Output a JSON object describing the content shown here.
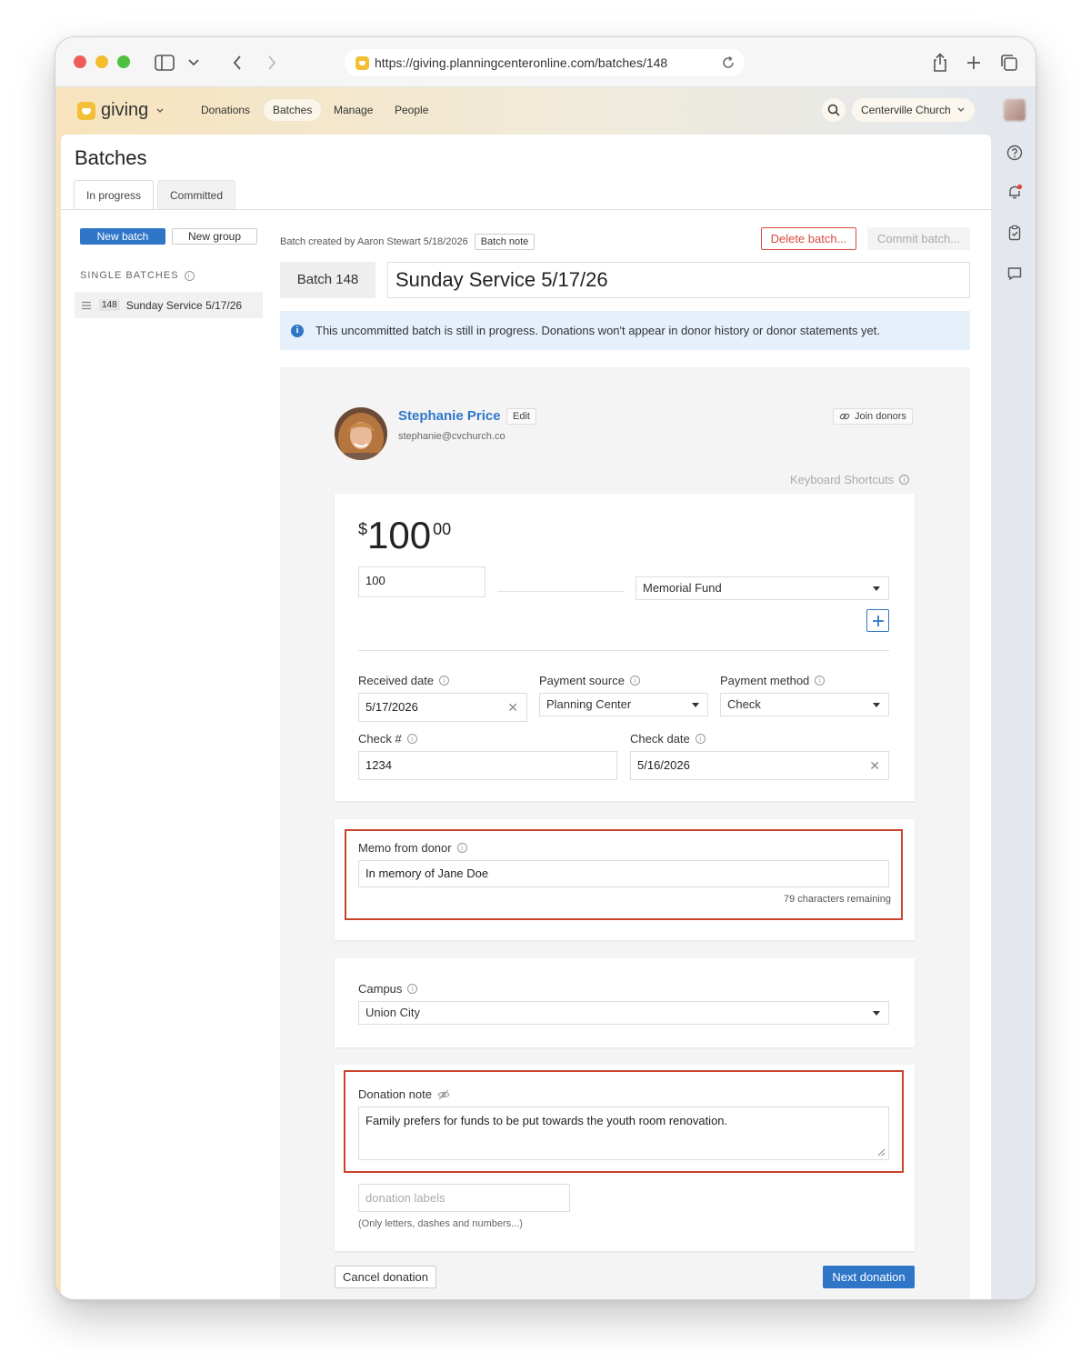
{
  "browser": {
    "url": "https://giving.planningcenteronline.com/batches/148"
  },
  "app": {
    "name": "giving",
    "nav": [
      "Donations",
      "Batches",
      "Manage",
      "People"
    ],
    "active_nav": "Batches",
    "organization": "Centerville Church"
  },
  "page": {
    "title": "Batches",
    "tabs": [
      "In progress",
      "Committed"
    ],
    "active_tab": "In progress"
  },
  "sidebar": {
    "new_batch": "New batch",
    "new_group": "New group",
    "heading": "SINGLE BATCHES",
    "items": [
      {
        "number": "148",
        "name": "Sunday Service 5/17/26"
      }
    ]
  },
  "batch": {
    "meta": "Batch created by Aaron Stewart 5/18/2026",
    "note_button": "Batch note",
    "delete_button": "Delete batch...",
    "commit_button": "Commit batch...",
    "number_label": "Batch 148",
    "name": "Sunday Service 5/17/26",
    "info": "This uncommitted batch is still in progress. Donations won't appear in donor history or donor statements yet."
  },
  "donor": {
    "name": "Stephanie Price",
    "edit": "Edit",
    "email": "stephanie@cvchurch.co",
    "join": "Join donors"
  },
  "shortcuts": "Keyboard Shortcuts",
  "donation": {
    "amount_symbol": "$",
    "amount_whole": "100",
    "amount_cents": "00",
    "amount_input": "100",
    "fund": "Memorial Fund",
    "received_date_label": "Received date",
    "received_date": "5/17/2026",
    "payment_source_label": "Payment source",
    "payment_source": "Planning Center",
    "payment_method_label": "Payment method",
    "payment_method": "Check",
    "check_number_label": "Check #",
    "check_number": "1234",
    "check_date_label": "Check date",
    "check_date": "5/16/2026",
    "memo_label": "Memo from donor",
    "memo": "In memory of Jane Doe",
    "memo_remaining": "79 characters remaining",
    "campus_label": "Campus",
    "campus": "Union City",
    "note_label": "Donation note",
    "note": "Family prefers for funds to be put towards the youth room renovation.",
    "labels_placeholder": "donation labels",
    "labels_help": "(Only letters, dashes and numbers...)",
    "cancel": "Cancel donation",
    "next": "Next donation"
  },
  "colors": {
    "primary": "#2f76c9",
    "danger": "#d94b3f",
    "highlight": "#c8442e",
    "brand": "#f3bf37"
  }
}
